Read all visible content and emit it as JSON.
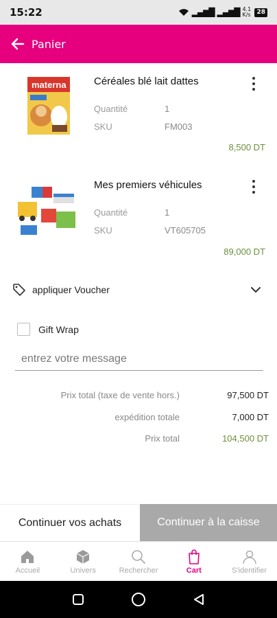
{
  "status_bar": {
    "time": "15:22",
    "network": "4.1 K/s",
    "battery": "28"
  },
  "header": {
    "title": "Panier"
  },
  "cart": {
    "items": [
      {
        "name": "Céréales blé lait dattes",
        "quantity_label": "Quantité",
        "quantity": "1",
        "sku_label": "SKU",
        "sku": "FM003",
        "price": "8,500 DT",
        "image_brand": "materna"
      },
      {
        "name": "Mes premiers véhicules",
        "quantity_label": "Quantité",
        "quantity": "1",
        "sku_label": "SKU",
        "sku": "VT605705",
        "price": "89,000 DT"
      }
    ],
    "voucher_label": "appliquer Voucher",
    "gift_wrap_label": "Gift Wrap",
    "gift_wrap_checked": false,
    "message_placeholder": "entrez votre message",
    "totals": {
      "subtotal_label": "Prix total (taxe de vente hors.)",
      "subtotal": "97,500 DT",
      "shipping_label": "expédition totale",
      "shipping": "7,000 DT",
      "total_label": "Prix total",
      "total": "104,500 DT"
    },
    "continue_label": "Continuer vos achats",
    "checkout_label": "Continuer à la caisse"
  },
  "bottom_nav": {
    "items": [
      {
        "label": "Accueil",
        "icon": "home-icon"
      },
      {
        "label": "Univers",
        "icon": "cube-icon"
      },
      {
        "label": "Rechercher",
        "icon": "search-icon"
      },
      {
        "label": "Cart",
        "icon": "bag-icon",
        "active": true
      },
      {
        "label": "S'identifier",
        "icon": "user-icon"
      }
    ]
  },
  "colors": {
    "brand": "#e6007e",
    "price_green": "#6b8f3a",
    "checkout_bg": "#a9a9a9"
  }
}
